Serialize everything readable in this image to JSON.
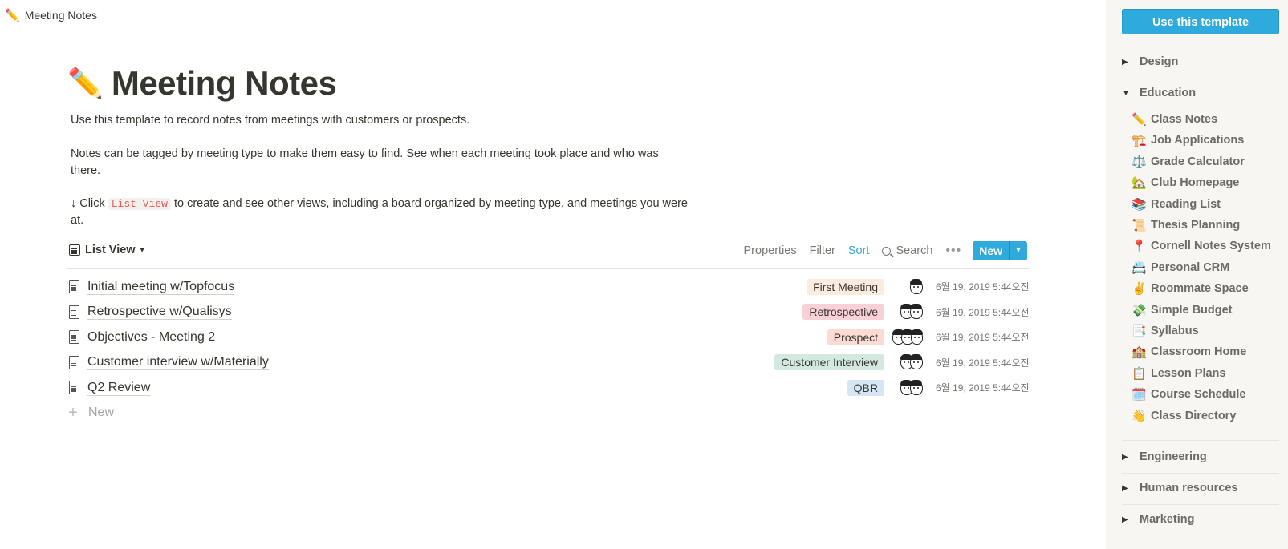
{
  "breadcrumb": {
    "emoji": "✏️",
    "title": "Meeting Notes"
  },
  "page": {
    "emoji": "✏️",
    "title": "Meeting Notes",
    "desc1": "Use this template to record notes from meetings with customers or prospects.",
    "desc2": "Notes can be tagged by meeting type to make them easy to find. See when each meeting took place and who was there.",
    "desc3_prefix": "↓ Click ",
    "desc3_code": "List View",
    "desc3_suffix": " to create and see other views, including a board organized by meeting type, and meetings you were at."
  },
  "view": {
    "label": "List View",
    "properties": "Properties",
    "filter": "Filter",
    "sort": "Sort",
    "search": "Search",
    "new": "New"
  },
  "rows": [
    {
      "title": "Initial meeting w/Topfocus",
      "tag": "First Meeting",
      "tag_color": "#fbecdd",
      "avatars": 1,
      "date": "6월 19, 2019 5:44오전"
    },
    {
      "title": "Retrospective w/Qualisys",
      "tag": "Retrospective",
      "tag_color": "#f8d0d6",
      "avatars": 2,
      "date": "6월 19, 2019 5:44오전"
    },
    {
      "title": "Objectives - Meeting 2",
      "tag": "Prospect",
      "tag_color": "#fbdbd2",
      "avatars": 3,
      "date": "6월 19, 2019 5:44오전"
    },
    {
      "title": "Customer interview w/Materially",
      "tag": "Customer Interview",
      "tag_color": "#d3e9df",
      "avatars": 2,
      "date": "6월 19, 2019 5:44오전"
    },
    {
      "title": "Q2 Review",
      "tag": "QBR",
      "tag_color": "#d6e6f5",
      "avatars": 2,
      "date": "6월 19, 2019 5:44오전"
    }
  ],
  "new_row_label": "New",
  "sidebar": {
    "use_template": "Use this template",
    "categories": {
      "design": "Design",
      "education": "Education",
      "engineering": "Engineering",
      "human_resources": "Human resources",
      "marketing": "Marketing"
    },
    "education_items": [
      {
        "emoji": "✏️",
        "label": "Class Notes"
      },
      {
        "emoji": "🏗️",
        "label": "Job Applications"
      },
      {
        "emoji": "⚖️",
        "label": "Grade Calculator"
      },
      {
        "emoji": "🏡",
        "label": "Club Homepage"
      },
      {
        "emoji": "📚",
        "label": "Reading List"
      },
      {
        "emoji": "📜",
        "label": "Thesis Planning"
      },
      {
        "emoji": "📍",
        "label": "Cornell Notes System"
      },
      {
        "emoji": "📇",
        "label": "Personal CRM"
      },
      {
        "emoji": "✌️",
        "label": "Roommate Space"
      },
      {
        "emoji": "💸",
        "label": "Simple Budget"
      },
      {
        "emoji": "📑",
        "label": "Syllabus"
      },
      {
        "emoji": "🏫",
        "label": "Classroom Home"
      },
      {
        "emoji": "📋",
        "label": "Lesson Plans"
      },
      {
        "emoji": "🗓️",
        "label": "Course Schedule"
      },
      {
        "emoji": "👋",
        "label": "Class Directory"
      }
    ]
  }
}
